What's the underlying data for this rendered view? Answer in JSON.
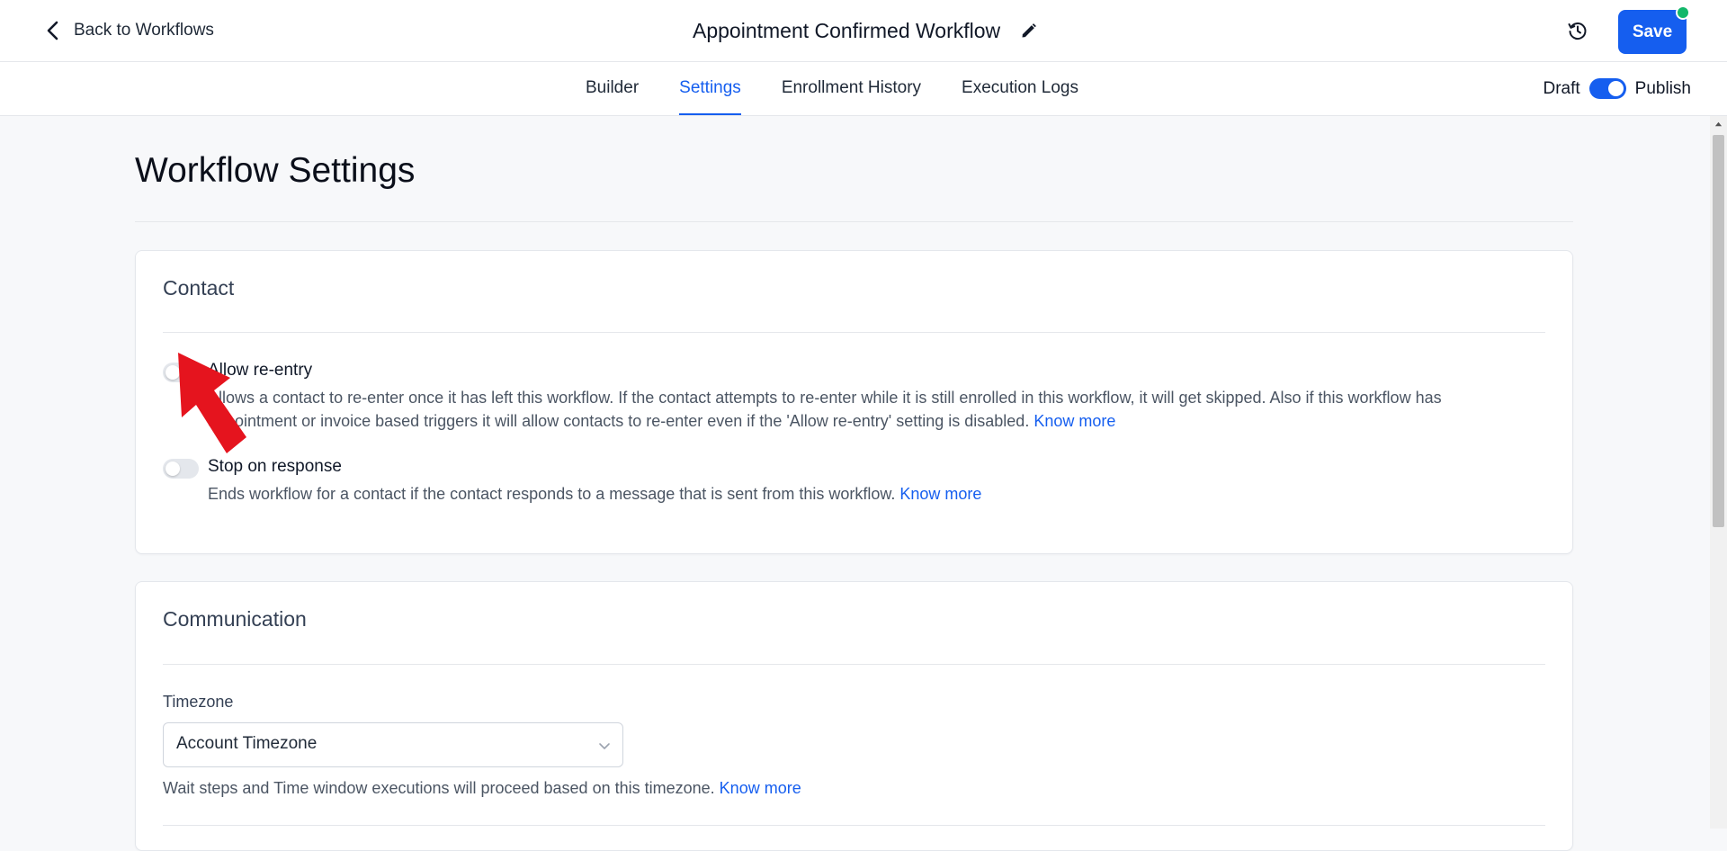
{
  "header": {
    "back_label": "Back to Workflows",
    "workflow_title": "Appointment Confirmed Workflow",
    "save_label": "Save",
    "edit_icon": "pencil-icon",
    "history_icon": "history-clock-icon",
    "status_color": "#12b76a"
  },
  "tabs": [
    {
      "label": "Builder",
      "active": false
    },
    {
      "label": "Settings",
      "active": true
    },
    {
      "label": "Enrollment History",
      "active": false
    },
    {
      "label": "Execution Logs",
      "active": false
    }
  ],
  "publish_toggle": {
    "draft_label": "Draft",
    "publish_label": "Publish",
    "state": "on"
  },
  "page": {
    "title": "Workflow Settings"
  },
  "contact_section": {
    "title": "Contact",
    "settings": [
      {
        "label": "Allow re-entry",
        "enabled": false,
        "description": "Allows a contact to re-enter once it has left this workflow. If the contact attempts to re-enter while it is still enrolled in this workflow, it will get skipped. Also if this workflow has appointment or invoice based triggers it will allow contacts to re-enter even if the 'Allow re-entry' setting is disabled.",
        "link_label": "Know more"
      },
      {
        "label": "Stop on response",
        "enabled": false,
        "description": "Ends workflow for a contact if the contact responds to a message that is sent from this workflow.",
        "link_label": "Know more"
      }
    ]
  },
  "communication_section": {
    "title": "Communication",
    "timezone_label": "Timezone",
    "timezone_value": "Account Timezone",
    "timezone_help": "Wait steps and Time window executions will proceed based on this timezone.",
    "link_label": "Know more"
  },
  "colors": {
    "accent": "#155eef",
    "annotation_arrow": "#e5141e"
  }
}
